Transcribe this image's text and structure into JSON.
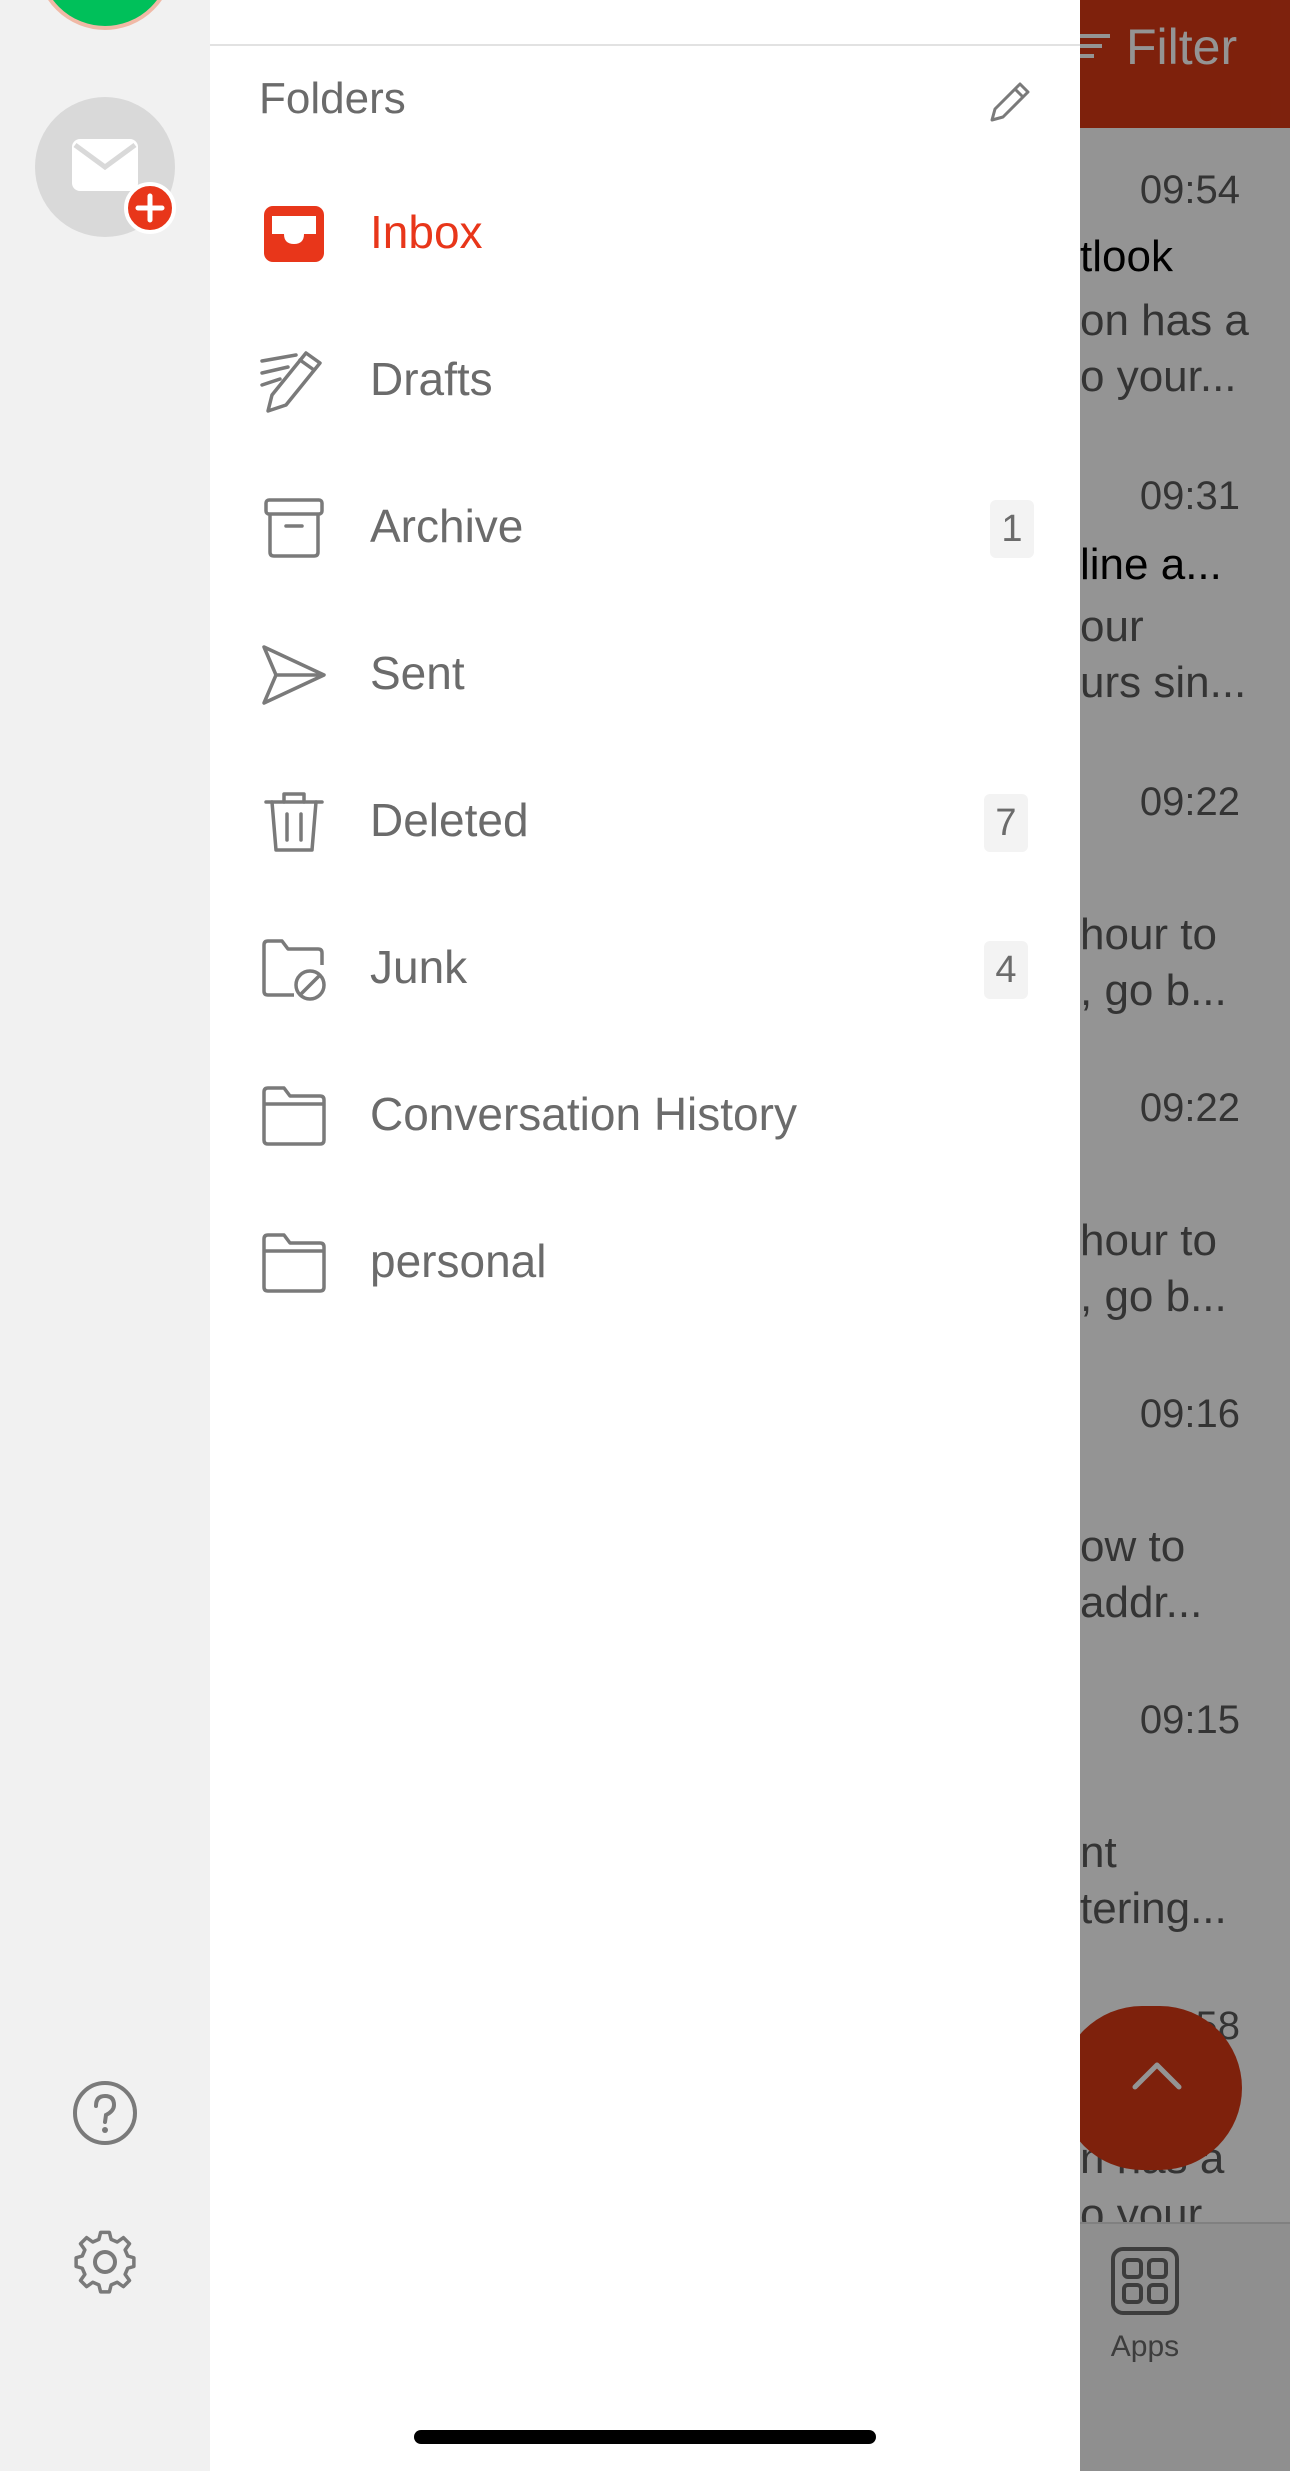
{
  "background_mail": {
    "filter_label": "Filter",
    "items": [
      {
        "time": "09:54",
        "line1": "tlook",
        "line2": "on has a",
        "line3": "o your..."
      },
      {
        "time": "09:31",
        "line1": "line a...",
        "line2": "our",
        "line3": "urs sin..."
      },
      {
        "time": "09:22",
        "line1": "",
        "line2": "hour to",
        "line3": ", go b..."
      },
      {
        "time": "09:22",
        "line1": "",
        "line2": "hour to",
        "line3": ", go b..."
      },
      {
        "time": "09:16",
        "line1": "",
        "line2": "ow to",
        "line3": " addr..."
      },
      {
        "time": "09:15",
        "line1": "",
        "line2": "nt",
        "line3": "tering..."
      },
      {
        "time": "58",
        "line1": "",
        "line2": "n has a",
        "line3": "o your"
      }
    ],
    "apps_label": "Apps"
  },
  "drawer": {
    "title": "Folders",
    "folders": [
      {
        "label": "Inbox",
        "icon": "inbox-icon",
        "count": ""
      },
      {
        "label": "Drafts",
        "icon": "pencil-lines-icon",
        "count": ""
      },
      {
        "label": "Archive",
        "icon": "archive-box-icon",
        "count": "1"
      },
      {
        "label": "Sent",
        "icon": "paper-plane-icon",
        "count": ""
      },
      {
        "label": "Deleted",
        "icon": "trash-icon",
        "count": "7"
      },
      {
        "label": "Junk",
        "icon": "folder-blocked-icon",
        "count": "4"
      },
      {
        "label": "Conversation History",
        "icon": "folder-icon",
        "count": ""
      },
      {
        "label": "personal",
        "icon": "folder-icon",
        "count": ""
      }
    ]
  },
  "colors": {
    "accent": "#e8361a",
    "header_red": "#d93a16",
    "account_green": "#00c05a",
    "rail_bg": "#f1f1f1",
    "muted_text": "#6b6b6b"
  }
}
